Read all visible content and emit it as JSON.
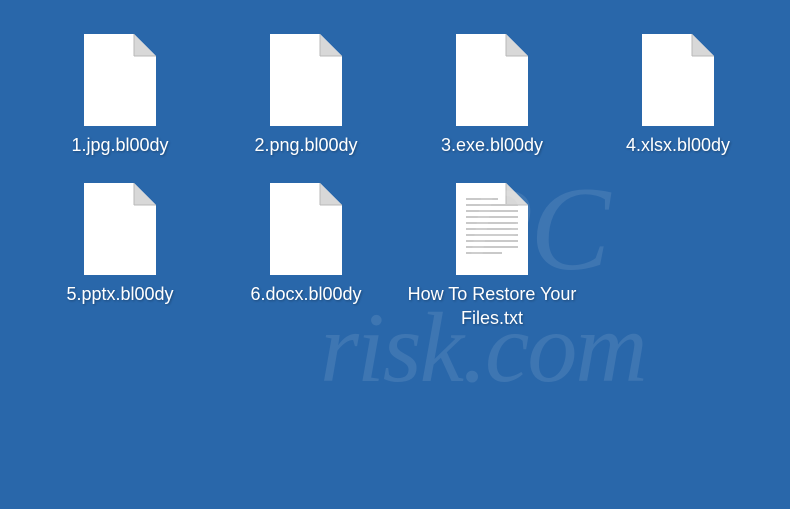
{
  "files": [
    {
      "name": "1.jpg.bl00dy",
      "icon": "blank"
    },
    {
      "name": "2.png.bl00dy",
      "icon": "blank"
    },
    {
      "name": "3.exe.bl00dy",
      "icon": "blank"
    },
    {
      "name": "4.xlsx.bl00dy",
      "icon": "blank"
    },
    {
      "name": "5.pptx.bl00dy",
      "icon": "blank"
    },
    {
      "name": "6.docx.bl00dy",
      "icon": "blank"
    },
    {
      "name": "How To Restore Your Files.txt",
      "icon": "text"
    }
  ],
  "watermark": {
    "line1": "PC",
    "line2": "risk.com"
  }
}
